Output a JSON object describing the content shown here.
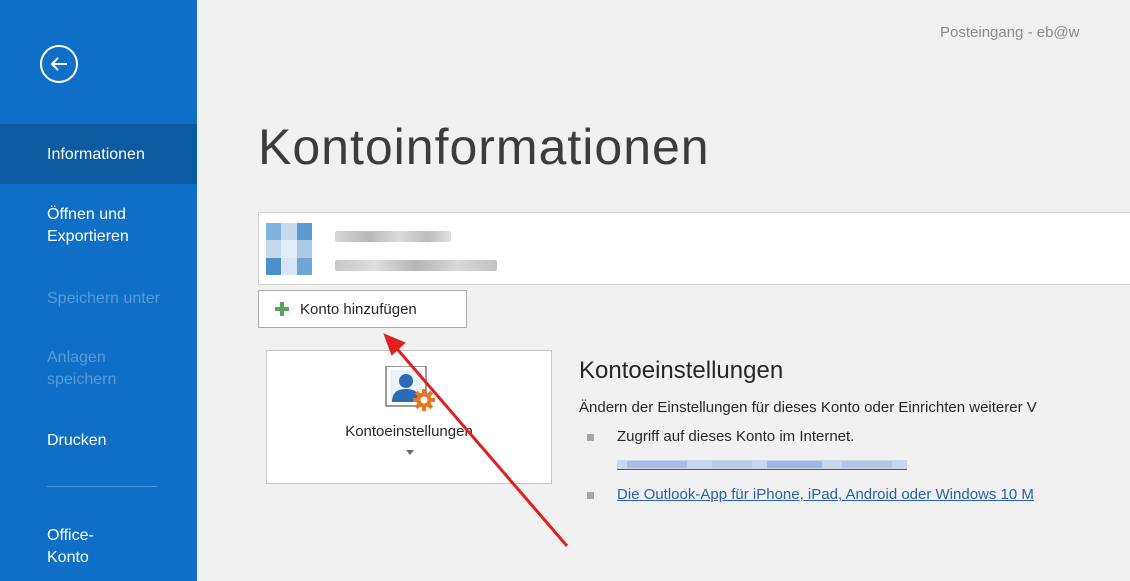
{
  "window": {
    "title": "Posteingang - eb@w"
  },
  "sidebar": {
    "items": [
      {
        "label": "Informationen",
        "state": "active"
      },
      {
        "label": "Öffnen und Exportieren",
        "state": "enabled"
      },
      {
        "label": "Speichern unter",
        "state": "disabled"
      },
      {
        "label": "Anlagen speichern",
        "state": "disabled"
      },
      {
        "label": "Drucken",
        "state": "enabled"
      },
      {
        "label": "Office-Konto",
        "state": "enabled"
      }
    ]
  },
  "main": {
    "title": "Kontoinformationen",
    "add_account_label": "Konto hinzufügen",
    "settings_tile_label": "Kontoeinstellungen",
    "settings": {
      "title": "Kontoeinstellungen",
      "description": "Ändern der Einstellungen für dieses Konto oder Einrichten weiterer V",
      "bullet1": "Zugriff auf dieses Konto im Internet.",
      "bullet2_link": "Die Outlook-App für iPhone, iPad, Android oder Windows 10 M"
    }
  },
  "colors": {
    "sidebar_bg": "#0f6fc6",
    "sidebar_active": "#0b5aa2",
    "annotation_arrow": "#e02020",
    "link": "#2a5fa8"
  }
}
